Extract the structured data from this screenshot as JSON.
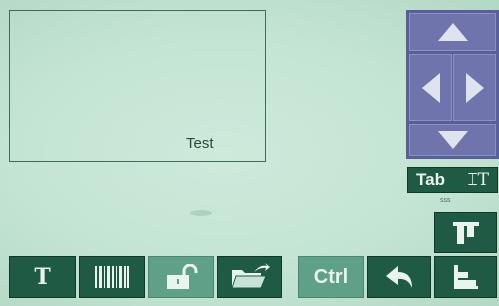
{
  "preview": {
    "label": "Test"
  },
  "navigation": {
    "up_icon": "arrow-up",
    "down_icon": "arrow-down",
    "left_icon": "arrow-left",
    "right_icon": "arrow-right"
  },
  "tab_button": {
    "label": "Tab",
    "icon": "text-cursor-icon",
    "cursor_glyph": "⌶T",
    "caption": "sss"
  },
  "align_buttons": [
    {
      "icon": "align-top-icon"
    },
    {
      "icon": "align-bottom-left-icon"
    }
  ],
  "toolbar": {
    "text_icon": "text-tool-icon",
    "text_glyph": "T",
    "barcode_icon": "barcode-icon",
    "lock_icon": "unlock-icon",
    "folder_icon": "open-folder-icon",
    "ctrl_label": "Ctrl",
    "undo_icon": "undo-icon"
  },
  "colors": {
    "background": "#c4e4d3",
    "button": "#1f5a44",
    "button_disabled": "#5fa088",
    "pad": "#5a5f9a",
    "pad_cell": "#6f74ad"
  }
}
